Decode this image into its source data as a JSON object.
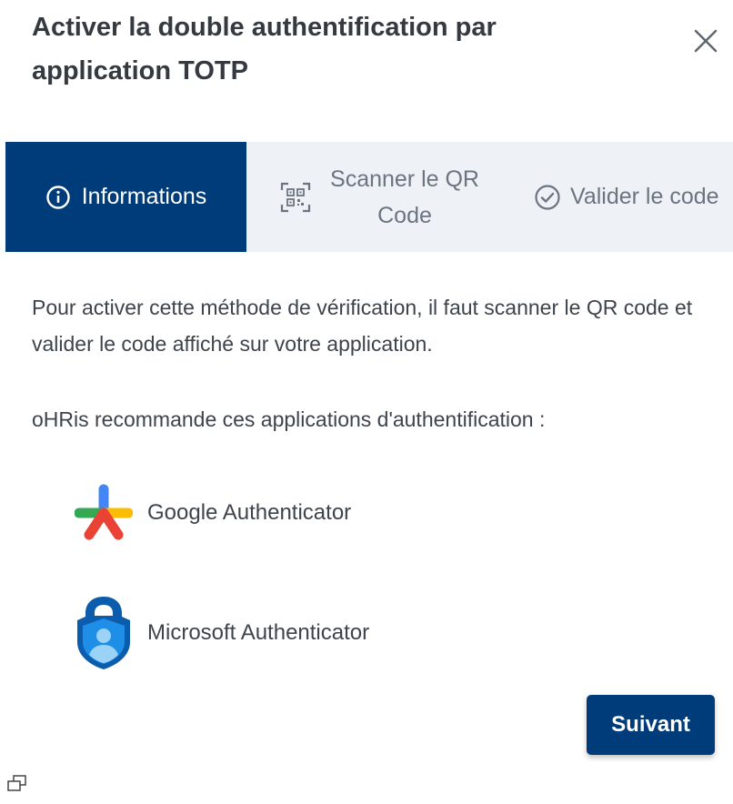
{
  "dialog": {
    "title": "Activer la double authentification par application TOTP",
    "close_icon": "close-icon"
  },
  "stepper": {
    "steps": [
      {
        "label": "Informations",
        "icon": "info-circle-icon",
        "active": true
      },
      {
        "label": "Scanner le QR Code",
        "icon": "qr-code-icon",
        "active": false
      },
      {
        "label": "Valider le code",
        "icon": "check-circle-icon",
        "active": false
      }
    ],
    "active_color": "#003b7a",
    "inactive_bg": "#eef1f5"
  },
  "content": {
    "intro": "Pour activer cette méthode de vérification, il faut scanner le QR code et valider le code affiché sur votre application.",
    "recommendation": "oHRis recommande ces applications d'authentification :",
    "apps": [
      {
        "name": "Google Authenticator",
        "icon": "google-authenticator-logo"
      },
      {
        "name": "Microsoft Authenticator",
        "icon": "microsoft-authenticator-logo"
      }
    ]
  },
  "footer": {
    "next_label": "Suivant",
    "button_color": "#003b7a"
  }
}
